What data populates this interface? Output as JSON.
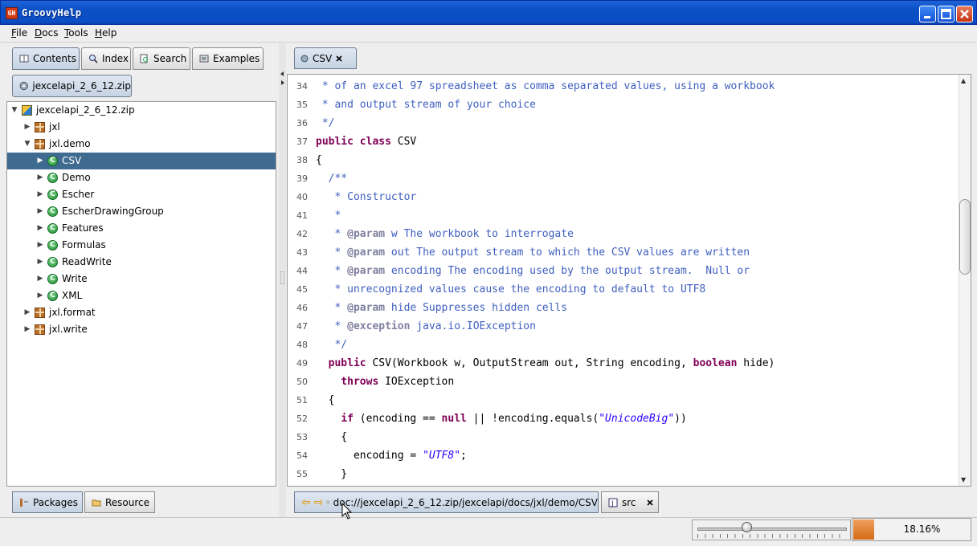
{
  "window": {
    "title": "GroovyHelp",
    "app_icon_text": "GH"
  },
  "menu": [
    {
      "label": "File",
      "key": "F",
      "rest": "ile"
    },
    {
      "label": "Docs",
      "key": "D",
      "rest": "ocs"
    },
    {
      "label": "Tools",
      "key": "T",
      "rest": "ools"
    },
    {
      "label": "Help",
      "key": "H",
      "rest": "elp"
    }
  ],
  "left_tabs": [
    "Contents",
    "Index",
    "Search",
    "Examples"
  ],
  "archive_tab": "jexcelapi_2_6_12.zip",
  "tree": [
    {
      "label": "jexcelapi_2_6_12.zip",
      "icon": "zip-icon",
      "level": 0,
      "expanded": true,
      "selected": false
    },
    {
      "label": "jxl",
      "icon": "package-icon",
      "level": 1,
      "expanded": false,
      "selected": false
    },
    {
      "label": "jxl.demo",
      "icon": "package-icon",
      "level": 1,
      "expanded": true,
      "selected": false
    },
    {
      "label": "CSV",
      "icon": "class-icon",
      "level": 2,
      "expanded": false,
      "selected": true
    },
    {
      "label": "Demo",
      "icon": "class-icon",
      "level": 2,
      "expanded": false,
      "selected": false
    },
    {
      "label": "Escher",
      "icon": "class-icon",
      "level": 2,
      "expanded": false,
      "selected": false
    },
    {
      "label": "EscherDrawingGroup",
      "icon": "class-icon",
      "level": 2,
      "expanded": false,
      "selected": false
    },
    {
      "label": "Features",
      "icon": "class-icon",
      "level": 2,
      "expanded": false,
      "selected": false
    },
    {
      "label": "Formulas",
      "icon": "class-icon",
      "level": 2,
      "expanded": false,
      "selected": false
    },
    {
      "label": "ReadWrite",
      "icon": "class-icon",
      "level": 2,
      "expanded": false,
      "selected": false
    },
    {
      "label": "Write",
      "icon": "class-icon",
      "level": 2,
      "expanded": false,
      "selected": false
    },
    {
      "label": "XML",
      "icon": "class-icon",
      "level": 2,
      "expanded": false,
      "selected": false
    },
    {
      "label": "jxl.format",
      "icon": "package-icon",
      "level": 1,
      "expanded": false,
      "selected": false
    },
    {
      "label": "jxl.write",
      "icon": "package-icon",
      "level": 1,
      "expanded": false,
      "selected": false
    }
  ],
  "bottom_left_tabs": [
    "Packages",
    "Resource"
  ],
  "editor": {
    "tab_label": "CSV",
    "lines": [
      {
        "n": "34",
        "parts": [
          [
            "cm",
            " * of an excel 97 spreadsheet as comma separated values, using a workbook"
          ]
        ]
      },
      {
        "n": "35",
        "parts": [
          [
            "cm",
            " * and output stream of your choice"
          ]
        ]
      },
      {
        "n": "36",
        "parts": [
          [
            "cm",
            " */"
          ]
        ]
      },
      {
        "n": "37",
        "parts": [
          [
            "kw",
            "public"
          ],
          [
            "",
            " "
          ],
          [
            "kw",
            "class"
          ],
          [
            "",
            " CSV"
          ]
        ]
      },
      {
        "n": "38",
        "parts": [
          [
            "",
            "{"
          ]
        ]
      },
      {
        "n": "39",
        "parts": [
          [
            "cm",
            "  /**"
          ]
        ]
      },
      {
        "n": "40",
        "parts": [
          [
            "cm",
            "   * Constructor"
          ]
        ]
      },
      {
        "n": "41",
        "parts": [
          [
            "cm",
            "   *"
          ]
        ]
      },
      {
        "n": "42",
        "parts": [
          [
            "cm",
            "   * "
          ],
          [
            "tag",
            "@param"
          ],
          [
            "cm",
            " w The workbook to interrogate"
          ]
        ]
      },
      {
        "n": "43",
        "parts": [
          [
            "cm",
            "   * "
          ],
          [
            "tag",
            "@param"
          ],
          [
            "cm",
            " out The output stream to which the CSV values are written"
          ]
        ]
      },
      {
        "n": "44",
        "parts": [
          [
            "cm",
            "   * "
          ],
          [
            "tag",
            "@param"
          ],
          [
            "cm",
            " encoding The encoding used by the output stream.  Null or"
          ]
        ]
      },
      {
        "n": "45",
        "parts": [
          [
            "cm",
            "   * unrecognized values cause the encoding to default to UTF8"
          ]
        ]
      },
      {
        "n": "46",
        "parts": [
          [
            "cm",
            "   * "
          ],
          [
            "tag",
            "@param"
          ],
          [
            "cm",
            " hide Suppresses hidden cells"
          ]
        ]
      },
      {
        "n": "47",
        "parts": [
          [
            "cm",
            "   * "
          ],
          [
            "tag",
            "@exception"
          ],
          [
            "cm",
            " java.io.IOException"
          ]
        ]
      },
      {
        "n": "48",
        "parts": [
          [
            "cm",
            "   */"
          ]
        ]
      },
      {
        "n": "49",
        "parts": [
          [
            "",
            "  "
          ],
          [
            "kw",
            "public"
          ],
          [
            "",
            " CSV(Workbook w, OutputStream out, String encoding, "
          ],
          [
            "kw",
            "boolean"
          ],
          [
            "",
            " hide)"
          ]
        ]
      },
      {
        "n": "50",
        "parts": [
          [
            "",
            "    "
          ],
          [
            "kw",
            "throws"
          ],
          [
            "",
            " IOException"
          ]
        ]
      },
      {
        "n": "51",
        "parts": [
          [
            "",
            "  {"
          ]
        ]
      },
      {
        "n": "52",
        "parts": [
          [
            "",
            "    "
          ],
          [
            "kw",
            "if"
          ],
          [
            "",
            " (encoding == "
          ],
          [
            "kw",
            "null"
          ],
          [
            "",
            " || !encoding.equals("
          ],
          [
            "str",
            "\"UnicodeBig\""
          ],
          [
            "",
            "))"
          ]
        ]
      },
      {
        "n": "53",
        "parts": [
          [
            "",
            "    {"
          ]
        ]
      },
      {
        "n": "54",
        "parts": [
          [
            "",
            "      encoding = "
          ],
          [
            "str",
            "\"UTF8\""
          ],
          [
            "",
            ";"
          ]
        ]
      },
      {
        "n": "55",
        "parts": [
          [
            "",
            "    }"
          ]
        ]
      }
    ]
  },
  "bottom_right": {
    "url": "doc://jexcelapi_2_6_12.zip/jexcelapi/docs/jxl/demo/CSV",
    "src_tab": "src"
  },
  "status": {
    "progress_text": "18.16%",
    "progress_value": 0.1816,
    "slider_value": 0.33
  },
  "colors": {
    "selection": "#3f6b91",
    "comment": "#3f5fbf",
    "keyword": "#7f0055",
    "string": "#2a00ff",
    "progress": "#d46a14"
  }
}
